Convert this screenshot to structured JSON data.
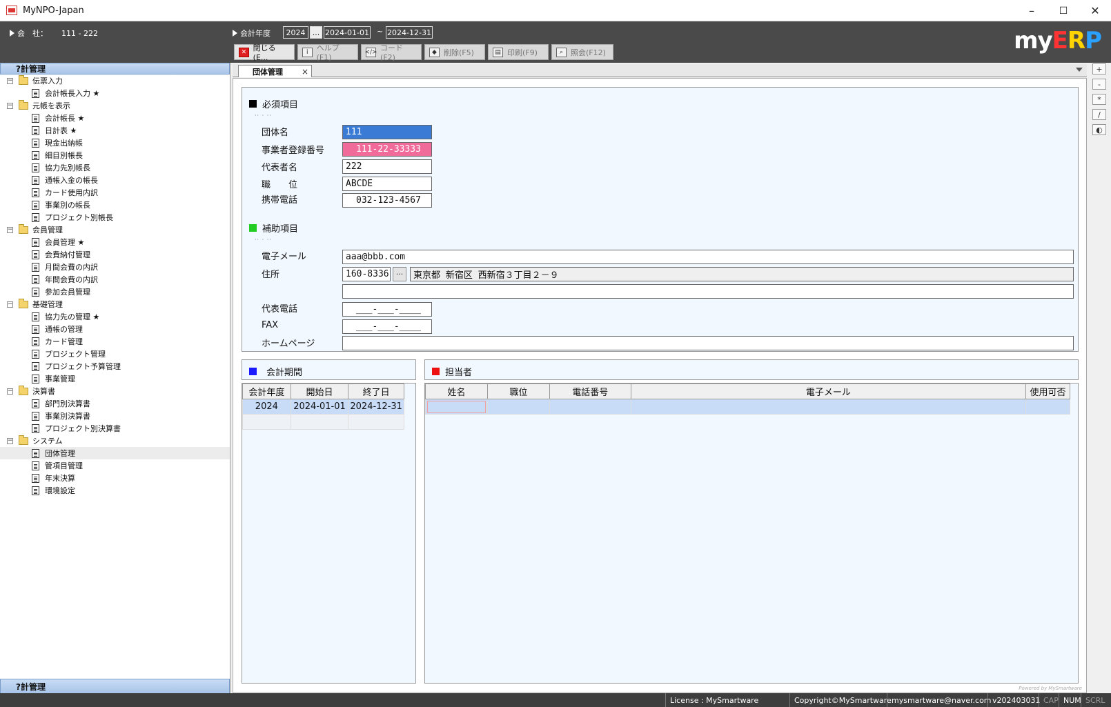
{
  "window": {
    "title": "MyNPO-Japan",
    "minimize": "–",
    "maximize": "☐",
    "close": "✕"
  },
  "header": {
    "company_label": "会　社：",
    "company_value": "111 - 222",
    "fiscal_label": "会計年度",
    "fiscal_year": "2024",
    "picker": "...",
    "start_date": "2024-01-01",
    "tilde": "~",
    "end_date": "2024-12-31",
    "logo": {
      "my": "my",
      "e": "E",
      "r": "R",
      "p": "P"
    },
    "colors": {
      "logo_e": "#ff3333",
      "logo_r": "#ffd400",
      "logo_p": "#2aa0ff"
    }
  },
  "toolbar": {
    "close": "閉じる(E...",
    "help": "ヘルプ(F1)",
    "code": "コード(F2)",
    "delete": "削除(F5)",
    "print": "印刷(F9)",
    "inquiry": "照会(F12)"
  },
  "sidebar": {
    "title": "?計管理",
    "footer": "?計管理",
    "tree": [
      {
        "type": "folder",
        "label": "伝票入力"
      },
      {
        "type": "item",
        "label": "会計帳長入力 ★"
      },
      {
        "type": "folder",
        "label": "元帳を表示"
      },
      {
        "type": "item",
        "label": "会計帳長 ★"
      },
      {
        "type": "item",
        "label": "日計表 ★"
      },
      {
        "type": "item",
        "label": "現金出納帳"
      },
      {
        "type": "item",
        "label": "細目別帳長"
      },
      {
        "type": "item",
        "label": "協力先別帳長"
      },
      {
        "type": "item",
        "label": "通帳入金の帳長"
      },
      {
        "type": "item",
        "label": "カード使用内訳"
      },
      {
        "type": "item",
        "label": "事業別の帳長"
      },
      {
        "type": "item",
        "label": "プロジェクト別帳長"
      },
      {
        "type": "folder",
        "label": "会員管理"
      },
      {
        "type": "item",
        "label": "会員管理 ★"
      },
      {
        "type": "item",
        "label": "会費納付管理"
      },
      {
        "type": "item",
        "label": "月間会費の内訳"
      },
      {
        "type": "item",
        "label": "年間会費の内訳"
      },
      {
        "type": "item",
        "label": "参加会員管理"
      },
      {
        "type": "folder",
        "label": "基礎管理"
      },
      {
        "type": "item",
        "label": "協力先の管理 ★"
      },
      {
        "type": "item",
        "label": "通帳の管理"
      },
      {
        "type": "item",
        "label": "カード管理"
      },
      {
        "type": "item",
        "label": "プロジェクト管理"
      },
      {
        "type": "item",
        "label": "プロジェクト予算管理"
      },
      {
        "type": "item",
        "label": "事業管理"
      },
      {
        "type": "folder",
        "label": "決算書"
      },
      {
        "type": "item",
        "label": "部門別決算書"
      },
      {
        "type": "item",
        "label": "事業別決算書"
      },
      {
        "type": "item",
        "label": "プロジェクト別決算書"
      },
      {
        "type": "folder",
        "label": "システム"
      },
      {
        "type": "item",
        "label": "団体管理",
        "selected": true
      },
      {
        "type": "item",
        "label": "管項目管理"
      },
      {
        "type": "item",
        "label": "年末決算"
      },
      {
        "type": "item",
        "label": "環境設定"
      }
    ]
  },
  "tab": {
    "label": "団体管理",
    "close": "×"
  },
  "side_buttons": [
    "+",
    "-",
    "*",
    "/",
    "◐"
  ],
  "required": {
    "title": "必須項目",
    "dots": "·· · ··",
    "org_name_label": "団体名",
    "org_name": "111",
    "reg_no_label": "事業者登録番号",
    "reg_no": "111-22-33333",
    "rep_label": "代表者名",
    "rep": "222",
    "position_label": "職　　位",
    "position": "ABCDE",
    "mobile_label": "携帯電話",
    "mobile": "032-123-4567"
  },
  "auxiliary": {
    "title": "補助項目",
    "dots": "·· · ··",
    "email_label": "電子メール",
    "email": "aaa@bbb.com",
    "address_label": "住所",
    "zip": "160-8336",
    "zip_btn": "···",
    "address1": "東京都 新宿区 西新宿３丁目２－９",
    "address2": "",
    "rep_phone_label": "代表電話",
    "rep_phone": "___-___-____",
    "fax_label": "FAX",
    "fax": "___-___-____",
    "homepage_label": "ホームページ",
    "homepage": ""
  },
  "fiscal_period": {
    "title": "会計期間",
    "columns": [
      "会計年度",
      "開始日",
      "終了日"
    ],
    "rows": [
      [
        "2024",
        "2024-01-01",
        "2024-12-31"
      ]
    ]
  },
  "staff": {
    "title": "担当者",
    "columns": [
      "姓名",
      "職位",
      "電話番号",
      "電子メール",
      "使用可否"
    ]
  },
  "powered_by": "Powered by MySmartware",
  "status": {
    "license": "License : MySmartware",
    "copyright": "Copyright©MySmartware",
    "email": "mysmartware@naver.com",
    "version": "v202403031",
    "cap": "CAP",
    "num": "NUM",
    "scrl": "SCRL"
  }
}
